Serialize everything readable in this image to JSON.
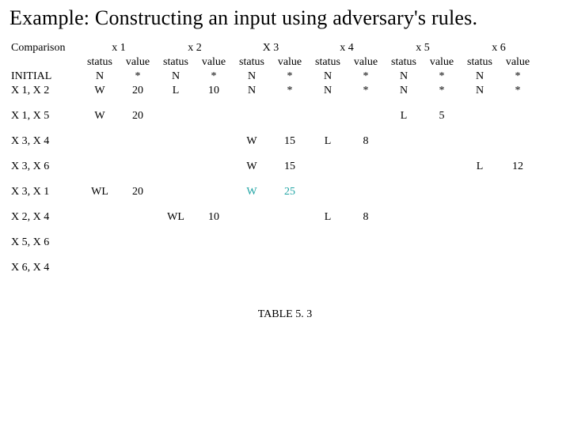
{
  "title": "Example: Constructing an input using adversary's rules.",
  "caption": "TABLE 5. 3",
  "group_labels": {
    "x1": "x 1",
    "x2": "x 2",
    "x3": "X 3",
    "x4": "x 4",
    "x5": "x 5",
    "x6": "x 6"
  },
  "sub_labels": {
    "status": "status",
    "value": "value"
  },
  "corner": "Comparison",
  "rows": [
    {
      "label": "INITIAL",
      "x1": {
        "s": "N",
        "v": "*"
      },
      "x2": {
        "s": "N",
        "v": "*"
      },
      "x3": {
        "s": "N",
        "v": "*"
      },
      "x4": {
        "s": "N",
        "v": "*"
      },
      "x5": {
        "s": "N",
        "v": "*"
      },
      "x6": {
        "s": "N",
        "v": "*"
      }
    },
    {
      "label": "X 1, X 2",
      "x1": {
        "s": "W",
        "v": "20"
      },
      "x2": {
        "s": "L",
        "v": "10"
      },
      "x3": {
        "s": "N",
        "v": "*"
      },
      "x4": {
        "s": "N",
        "v": "*"
      },
      "x5": {
        "s": "N",
        "v": "*"
      },
      "x6": {
        "s": "N",
        "v": "*"
      }
    },
    {
      "label": "X 1, X 5",
      "x1": {
        "s": "W",
        "v": "20"
      },
      "x2": {
        "s": "",
        "v": ""
      },
      "x3": {
        "s": "",
        "v": ""
      },
      "x4": {
        "s": "",
        "v": ""
      },
      "x5": {
        "s": "L",
        "v": "5"
      },
      "x6": {
        "s": "",
        "v": ""
      }
    },
    {
      "label": "X 3, X 4",
      "x1": {
        "s": "",
        "v": ""
      },
      "x2": {
        "s": "",
        "v": ""
      },
      "x3": {
        "s": "W",
        "v": "15"
      },
      "x4": {
        "s": "L",
        "v": "8"
      },
      "x5": {
        "s": "",
        "v": ""
      },
      "x6": {
        "s": "",
        "v": ""
      }
    },
    {
      "label": "X 3, X 6",
      "x1": {
        "s": "",
        "v": ""
      },
      "x2": {
        "s": "",
        "v": ""
      },
      "x3": {
        "s": "W",
        "v": "15"
      },
      "x4": {
        "s": "",
        "v": ""
      },
      "x5": {
        "s": "",
        "v": ""
      },
      "x6": {
        "s": "L",
        "v": "12"
      }
    },
    {
      "label": "X 3, X 1",
      "x1": {
        "s": "WL",
        "v": "20"
      },
      "x2": {
        "s": "",
        "v": ""
      },
      "x3": {
        "s": "W",
        "v": "25",
        "teal": true
      },
      "x4": {
        "s": "",
        "v": ""
      },
      "x5": {
        "s": "",
        "v": ""
      },
      "x6": {
        "s": "",
        "v": ""
      }
    },
    {
      "label": "X 2, X 4",
      "x1": {
        "s": "",
        "v": ""
      },
      "x2": {
        "s": "WL",
        "v": "10"
      },
      "x3": {
        "s": "",
        "v": ""
      },
      "x4": {
        "s": "L",
        "v": "8"
      },
      "x5": {
        "s": "",
        "v": ""
      },
      "x6": {
        "s": "",
        "v": ""
      }
    },
    {
      "label": "X 5, X 6",
      "x1": {
        "s": "",
        "v": ""
      },
      "x2": {
        "s": "",
        "v": ""
      },
      "x3": {
        "s": "",
        "v": ""
      },
      "x4": {
        "s": "",
        "v": ""
      },
      "x5": {
        "s": "",
        "v": ""
      },
      "x6": {
        "s": "",
        "v": ""
      }
    },
    {
      "label": "X 6, X 4",
      "x1": {
        "s": "",
        "v": ""
      },
      "x2": {
        "s": "",
        "v": ""
      },
      "x3": {
        "s": "",
        "v": ""
      },
      "x4": {
        "s": "",
        "v": ""
      },
      "x5": {
        "s": "",
        "v": ""
      },
      "x6": {
        "s": "",
        "v": ""
      }
    }
  ]
}
